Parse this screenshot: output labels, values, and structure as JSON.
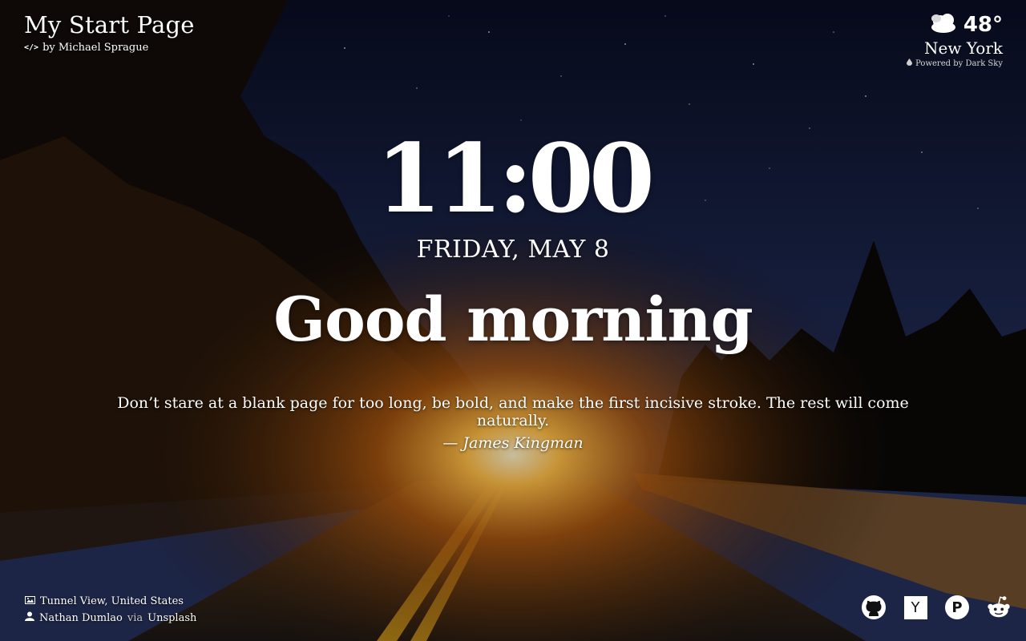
{
  "header": {
    "title": "My Start Page",
    "byline_prefix": "by",
    "author": "Michael Sprague",
    "code_icon": "code-icon"
  },
  "weather": {
    "icon": "cloud-icon",
    "temperature": "48°",
    "city": "New York",
    "powered_by": "Powered by Dark Sky"
  },
  "clock": {
    "time": "11:00",
    "date": "FRIDAY, MAY 8",
    "greeting": "Good morning"
  },
  "quote": {
    "text": "Don’t stare at a blank page for too long, be bold, and make the first incisive stroke. The rest will come naturally.",
    "author": "— James Kingman"
  },
  "photo_credit": {
    "location": "Tunnel View, United States",
    "photographer": "Nathan Dumlao",
    "via": "via",
    "source": "Unsplash"
  },
  "social_links": [
    {
      "name": "github",
      "icon": "github-icon"
    },
    {
      "name": "hacker-news",
      "label": "Y",
      "icon": "ycombinator-icon"
    },
    {
      "name": "product-hunt",
      "label": "P",
      "icon": "product-hunt-icon"
    },
    {
      "name": "reddit",
      "icon": "reddit-icon"
    }
  ],
  "colors": {
    "sky_top": "#0a0f26",
    "sky_mid": "#1d2850",
    "glow": "#ffb23a",
    "road": "#2a2320"
  }
}
